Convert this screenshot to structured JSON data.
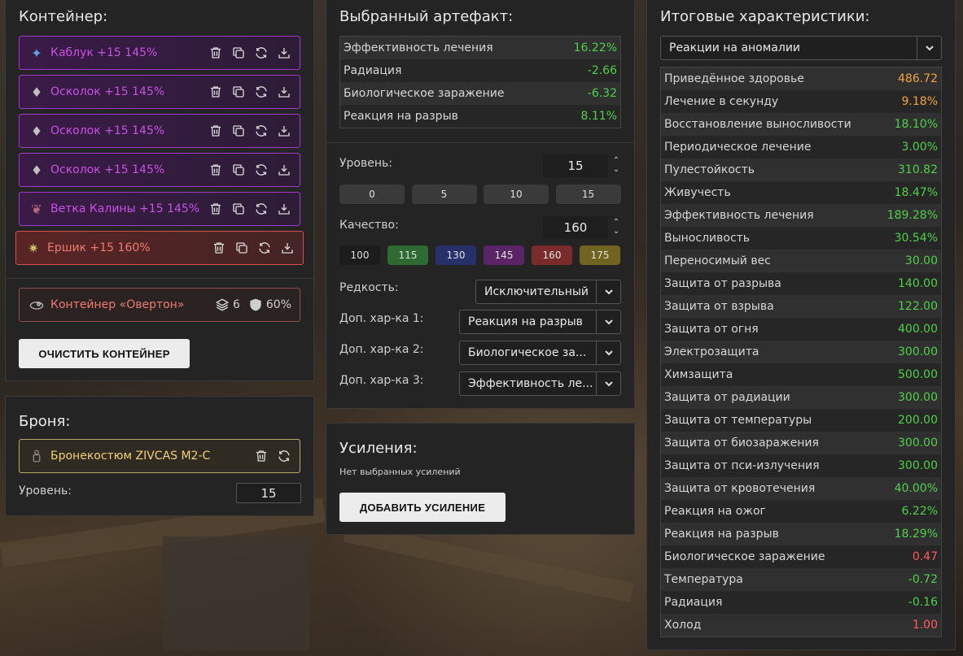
{
  "container": {
    "title": "Контейнер:",
    "slots": [
      {
        "name": "Каблук +15 145%",
        "icon": "kabluk-artifact-icon",
        "color": "#c951e6"
      },
      {
        "name": "Осколок +15 145%",
        "icon": "oskolok-artifact-icon",
        "color": "#c951e6"
      },
      {
        "name": "Осколок +15 145%",
        "icon": "oskolok-artifact-icon",
        "color": "#c951e6"
      },
      {
        "name": "Осколок +15 145%",
        "icon": "oskolok-artifact-icon",
        "color": "#c951e6"
      },
      {
        "name": "Ветка Калины +15 145%",
        "icon": "vetka-artifact-icon",
        "color": "#c951e6"
      },
      {
        "name": "Ершик +15 160%",
        "icon": "ershik-artifact-icon",
        "color": "#f07a72"
      }
    ],
    "container_item": {
      "name": "Контейнер «Овертон»",
      "slots_count": "6",
      "protection": "60%"
    },
    "clear_button": "ОЧИСТИТЬ КОНТЕЙНЕР"
  },
  "armor": {
    "title": "Броня:",
    "item_name": "Бронекостюм ZIVCAS M2-C",
    "level_label": "Уровень:",
    "level_value": "15"
  },
  "artifact": {
    "title": "Выбранный артефакт:",
    "stats": [
      {
        "label": "Эффективность лечения",
        "value": "16.22%",
        "tone": "green"
      },
      {
        "label": "Радиация",
        "value": "-2.66",
        "tone": "green"
      },
      {
        "label": "Биологическое заражение",
        "value": "-6.32",
        "tone": "green"
      },
      {
        "label": "Реакция на разрыв",
        "value": "8.11%",
        "tone": "green"
      }
    ],
    "level_label": "Уровень:",
    "level_value": "15",
    "level_presets": [
      "0",
      "5",
      "10",
      "15"
    ],
    "quality_label": "Качество:",
    "quality_value": "160",
    "quality_presets": [
      {
        "label": "100",
        "color": "#1c1c1c"
      },
      {
        "label": "115",
        "color": "#2f6a33"
      },
      {
        "label": "130",
        "color": "#27306a"
      },
      {
        "label": "145",
        "color": "#5a2466"
      },
      {
        "label": "160",
        "color": "#7a2c2c"
      },
      {
        "label": "175",
        "color": "#6f6420"
      }
    ],
    "rarity_label": "Редкость:",
    "rarity_value": "Исключительный",
    "extra1_label": "Доп. хар-ка 1:",
    "extra1_value": "Реакция на разрыв",
    "extra2_label": "Доп. хар-ка 2:",
    "extra2_value": "Биологическое за...",
    "extra3_label": "Доп. хар-ка 3:",
    "extra3_value": "Эффективность ле..."
  },
  "boosts": {
    "title": "Усиления:",
    "empty_text": "Нет выбранных усилений",
    "add_button": "ДОБАВИТЬ УСИЛЕНИЕ"
  },
  "summary": {
    "title": "Итоговые характеристики:",
    "filter_value": "Реакции на аномалии",
    "stats": [
      {
        "label": "Приведённое здоровье",
        "value": "486.72",
        "tone": "orange"
      },
      {
        "label": "Лечение в секунду",
        "value": "9.18%",
        "tone": "orange"
      },
      {
        "label": "Восстановление выносливости",
        "value": "18.10%",
        "tone": "green"
      },
      {
        "label": "Периодическое лечение",
        "value": "3.00%",
        "tone": "green"
      },
      {
        "label": "Пулестойкость",
        "value": "310.82",
        "tone": "green"
      },
      {
        "label": "Живучесть",
        "value": "18.47%",
        "tone": "green"
      },
      {
        "label": "Эффективность лечения",
        "value": "189.28%",
        "tone": "green"
      },
      {
        "label": "Выносливость",
        "value": "30.54%",
        "tone": "green"
      },
      {
        "label": "Переносимый вес",
        "value": "30.00",
        "tone": "green"
      },
      {
        "label": "Защита от разрыва",
        "value": "140.00",
        "tone": "green"
      },
      {
        "label": "Защита от взрыва",
        "value": "122.00",
        "tone": "green"
      },
      {
        "label": "Защита от огня",
        "value": "400.00",
        "tone": "green"
      },
      {
        "label": "Электрозащита",
        "value": "300.00",
        "tone": "green"
      },
      {
        "label": "Химзащита",
        "value": "500.00",
        "tone": "green"
      },
      {
        "label": "Защита от радиации",
        "value": "300.00",
        "tone": "green"
      },
      {
        "label": "Защита от температуры",
        "value": "200.00",
        "tone": "green"
      },
      {
        "label": "Защита от биозаражения",
        "value": "300.00",
        "tone": "green"
      },
      {
        "label": "Защита от пси-излучения",
        "value": "300.00",
        "tone": "green"
      },
      {
        "label": "Защита от кровотечения",
        "value": "40.00%",
        "tone": "green"
      },
      {
        "label": "Реакция на ожог",
        "value": "6.22%",
        "tone": "green"
      },
      {
        "label": "Реакция на разрыв",
        "value": "18.29%",
        "tone": "green"
      },
      {
        "label": "Биологическое заражение",
        "value": "0.47",
        "tone": "red"
      },
      {
        "label": "Температура",
        "value": "-0.72",
        "tone": "green"
      },
      {
        "label": "Радиация",
        "value": "-0.16",
        "tone": "green"
      },
      {
        "label": "Холод",
        "value": "1.00",
        "tone": "red"
      }
    ]
  }
}
